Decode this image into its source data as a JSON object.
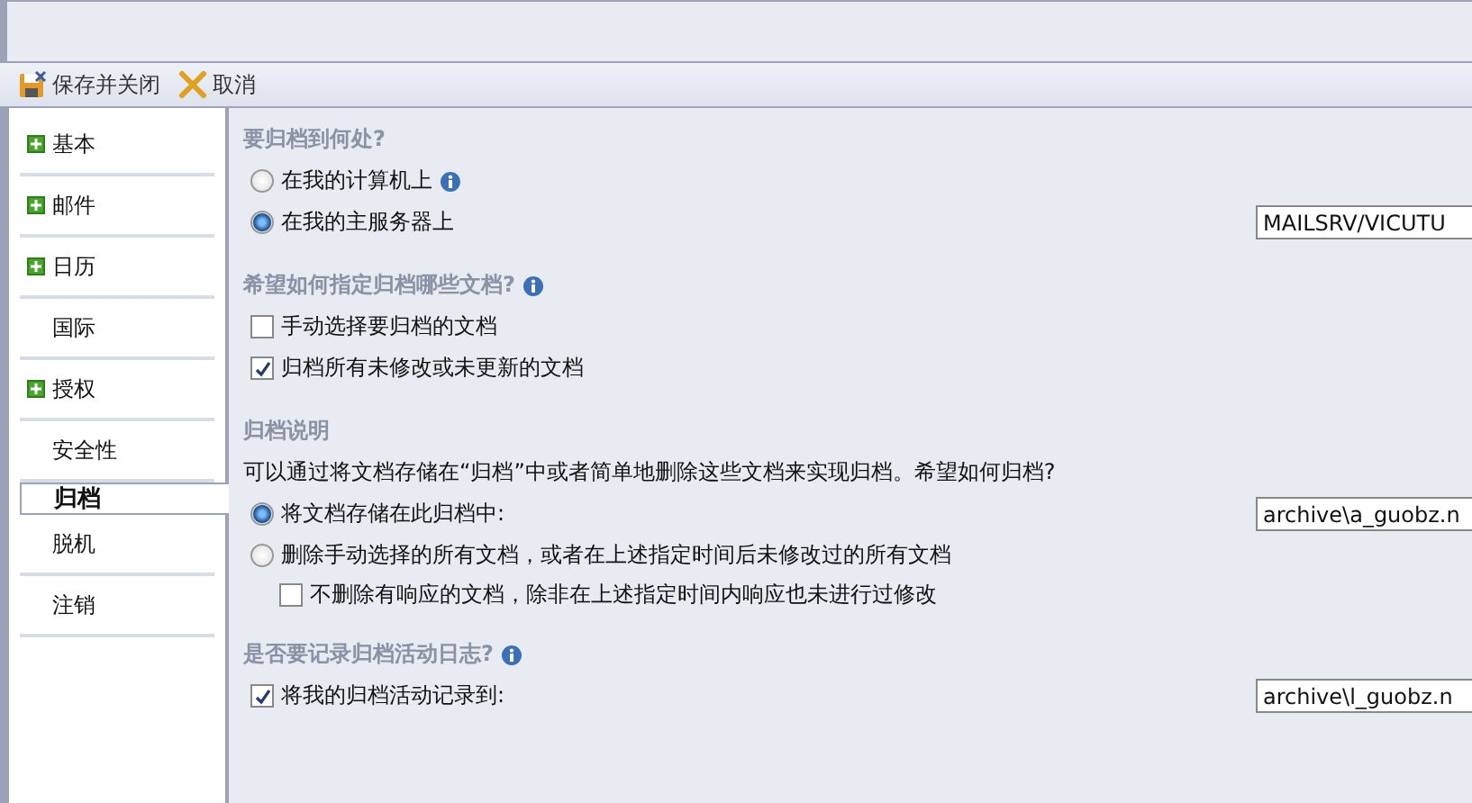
{
  "toolbar": [
    {
      "kind": "save",
      "label": "保存并关闭"
    },
    {
      "kind": "cancel",
      "label": "取消"
    }
  ],
  "sidebar": {
    "items": [
      {
        "label": "基本",
        "expandable": true,
        "selected": false
      },
      {
        "label": "邮件",
        "expandable": true,
        "selected": false
      },
      {
        "label": "日历",
        "expandable": true,
        "selected": false
      },
      {
        "label": "国际",
        "expandable": false,
        "selected": false
      },
      {
        "label": "授权",
        "expandable": true,
        "selected": false
      },
      {
        "label": "安全性",
        "expandable": false,
        "selected": false
      },
      {
        "label": "归档",
        "expandable": false,
        "selected": true
      },
      {
        "label": "脱机",
        "expandable": false,
        "selected": false
      },
      {
        "label": "注销",
        "expandable": false,
        "selected": false
      }
    ]
  },
  "content": [
    {
      "kind": "heading",
      "label": "要归档到何处?",
      "info": false
    },
    {
      "kind": "radio",
      "label": "在我的计算机上",
      "selected": false,
      "info": true
    },
    {
      "kind": "radio",
      "label": "在我的主服务器上",
      "selected": true,
      "field": "MAILSRV/VICUTU"
    },
    {
      "kind": "heading",
      "label": "希望如何指定归档哪些文档?",
      "info": true
    },
    {
      "kind": "checkbox",
      "label": "手动选择要归档的文档",
      "checked": false
    },
    {
      "kind": "checkbox",
      "label": "归档所有未修改或未更新的文档",
      "checked": true
    },
    {
      "kind": "heading",
      "label": "归档说明",
      "info": false
    },
    {
      "kind": "text",
      "label": "可以通过将文档存储在“归档”中或者简单地删除这些文档来实现归档。希望如何归档?"
    },
    {
      "kind": "radio",
      "label": "将文档存储在此归档中:",
      "selected": true,
      "field": "archive\\a_guobz.n"
    },
    {
      "kind": "radio",
      "label": "删除手动选择的所有文档，或者在上述指定时间后未修改过的所有文档",
      "selected": false,
      "children": [
        {
          "kind": "checkbox",
          "label": "不删除有响应的文档，除非在上述指定时间内响应也未进行过修改",
          "checked": false
        }
      ]
    },
    {
      "kind": "heading",
      "label": "是否要记录归档活动日志?",
      "info": true
    },
    {
      "kind": "checkbox",
      "label": "将我的归档活动记录到:",
      "checked": true,
      "field": "archive\\l_guobz.n"
    }
  ]
}
